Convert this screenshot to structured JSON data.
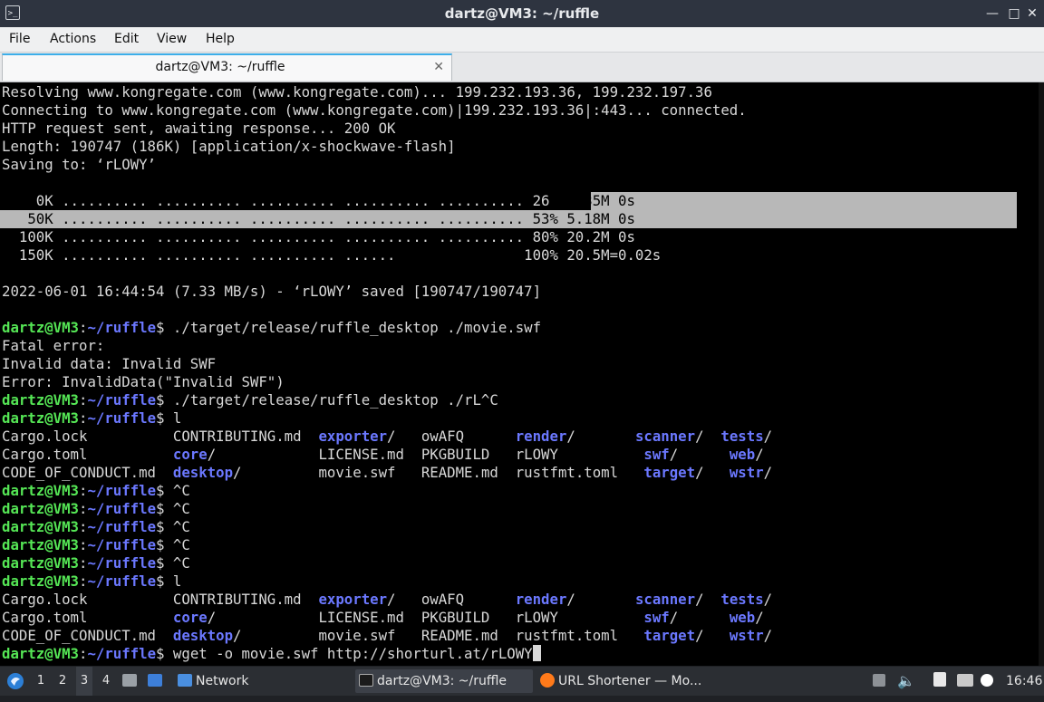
{
  "window": {
    "title": "dartz@VM3: ~/ruffle",
    "icon": "terminal-icon",
    "controls": [
      "minimize-icon",
      "maximize-icon",
      "close-icon"
    ],
    "minimize_glyph": "—",
    "maximize_glyph": "□",
    "close_glyph": "✕"
  },
  "menu": [
    "File",
    "Actions",
    "Edit",
    "View",
    "Help"
  ],
  "tab": {
    "label": "dartz@VM3: ~/ruffle",
    "close_glyph": "✕"
  },
  "prompt": {
    "user": "dartz@VM3",
    "sep": ":",
    "path": "~/ruffle",
    "dollar": "$"
  },
  "terminal": {
    "pre_lines": [
      "Resolving www.kongregate.com (www.kongregate.com)... 199.232.193.36, 199.232.197.36",
      "Connecting to www.kongregate.com (www.kongregate.com)|199.232.193.36|:443... connected.",
      "HTTP request sent, awaiting response... 200 OK",
      "Length: 190747 (186K) [application/x-shockwave-flash]",
      "Saving to: ‘rLOWY’",
      ""
    ],
    "progress_lines": [
      {
        "text": "    0K .......... .......... .......... .......... .......... 26% 4.35M 0s",
        "style": "partial"
      },
      {
        "text": "   50K .......... .......... .......... .......... .......... 53% 5.18M 0s",
        "style": "full"
      },
      {
        "text": "  100K .......... .......... .......... .......... .......... 80% 20.2M 0s",
        "style": "none"
      },
      {
        "text": "  150K .......... .......... .......... ......               100% 20.5M=0.02s",
        "style": "none"
      }
    ],
    "progress_split": {
      "left": "    0K .......... .......... .......... .......... .......... 26",
      "right": "% 4.35M 0s"
    },
    "post_lines": [
      "",
      "2022-06-01 16:44:54 (7.33 MB/s) - ‘rLOWY’ saved [190747/190747]",
      ""
    ],
    "cmd1": " ./target/release/ruffle_desktop ./movie.swf",
    "error_lines": [
      "Fatal error:",
      "Invalid data: Invalid SWF",
      "Error: InvalidData(\"Invalid SWF\")"
    ],
    "cmd2": " ./target/release/ruffle_desktop ./rL^C",
    "cmd_l": " l",
    "ls_rows": [
      [
        {
          "t": "Cargo.lock          ",
          "d": false
        },
        {
          "t": "CONTRIBUTING.md  ",
          "d": false
        },
        {
          "t": "exporter",
          "d": true
        },
        {
          "t": "/   ",
          "d": false
        },
        {
          "t": "owAFQ      ",
          "d": false
        },
        {
          "t": "render",
          "d": true
        },
        {
          "t": "/       ",
          "d": false
        },
        {
          "t": "scanner",
          "d": true
        },
        {
          "t": "/  ",
          "d": false
        },
        {
          "t": "tests",
          "d": true
        },
        {
          "t": "/",
          "d": false
        }
      ],
      [
        {
          "t": "Cargo.toml          ",
          "d": false
        },
        {
          "t": "core",
          "d": true
        },
        {
          "t": "/            ",
          "d": false
        },
        {
          "t": "LICENSE.md  ",
          "d": false
        },
        {
          "t": "PKGBUILD   ",
          "d": false
        },
        {
          "t": "rLOWY          ",
          "d": false
        },
        {
          "t": "swf",
          "d": true
        },
        {
          "t": "/      ",
          "d": false
        },
        {
          "t": "web",
          "d": true
        },
        {
          "t": "/",
          "d": false
        }
      ],
      [
        {
          "t": "CODE_OF_CONDUCT.md  ",
          "d": false
        },
        {
          "t": "desktop",
          "d": true
        },
        {
          "t": "/         ",
          "d": false
        },
        {
          "t": "movie.swf   ",
          "d": false
        },
        {
          "t": "README.md  ",
          "d": false
        },
        {
          "t": "rustfmt.toml   ",
          "d": false
        },
        {
          "t": "target",
          "d": true
        },
        {
          "t": "/   ",
          "d": false
        },
        {
          "t": "wstr",
          "d": true
        },
        {
          "t": "/",
          "d": false
        }
      ]
    ],
    "ctrl_c": " ^C",
    "ctrl_c_count": 5,
    "final_cmd": " wget -o movie.swf http://shorturl.at/rLOWY"
  },
  "taskbar": {
    "menu_icon": "start-menu-icon",
    "workspaces": [
      "1",
      "2",
      "3",
      "4"
    ],
    "active_workspace": "3",
    "network_label": "Network",
    "terminal_task": "dartz@VM3: ~/ruffle",
    "firefox_task": "URL Shortener — Mo...",
    "clock": "16:46"
  }
}
